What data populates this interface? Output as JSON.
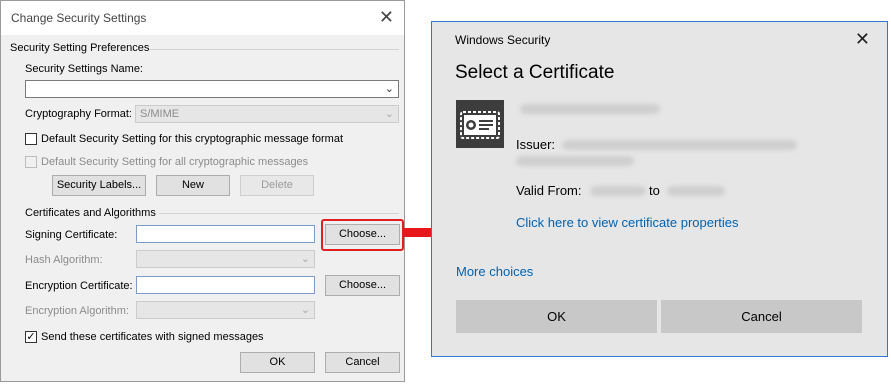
{
  "left_dialog": {
    "title": "Change Security Settings",
    "close_glyph": "✕",
    "prefs_group": "Security Setting Preferences",
    "name_label": "Security Settings Name:",
    "name_value": "",
    "crypto_label": "Cryptography Format:",
    "crypto_value": "S/MIME",
    "chk_default_format": "Default Security Setting for this cryptographic message format",
    "chk_default_all": "Default Security Setting for all cryptographic messages",
    "security_labels_btn": "Security Labels...",
    "new_btn": "New",
    "delete_btn": "Delete",
    "certs_group": "Certificates and Algorithms",
    "signing_label": "Signing Certificate:",
    "choose_btn_1": "Choose...",
    "hash_label": "Hash Algorithm:",
    "encryption_label": "Encryption Certificate:",
    "choose_btn_2": "Choose...",
    "enc_algo_label": "Encryption Algorithm:",
    "send_certs_label": "Send these certificates with signed messages",
    "send_certs_checked": "✓",
    "ok_btn": "OK",
    "cancel_btn": "Cancel",
    "dropdown_glyph": "⌄"
  },
  "right_dialog": {
    "title": "Windows Security",
    "close_glyph": "✕",
    "heading": "Select a Certificate",
    "issuer_label": "Issuer:",
    "valid_from_label": "Valid From:",
    "valid_to_label": "to",
    "view_properties_link": "Click here to view certificate properties",
    "more_choices_link": "More choices",
    "ok_btn": "OK",
    "cancel_btn": "Cancel"
  },
  "colors": {
    "highlight_red": "#e8171c",
    "link_blue": "#0063b1",
    "window_border_blue": "#2d7ad6"
  },
  "icons": [
    "close-icon",
    "dropdown-arrow-icon",
    "certificate-icon",
    "arrow-right-icon",
    "checkmark-icon"
  ]
}
